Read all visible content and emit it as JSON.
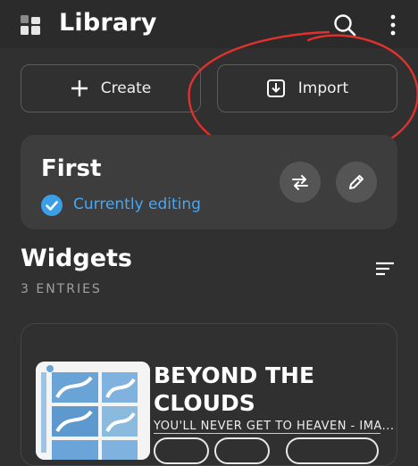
{
  "header": {
    "title": "Library",
    "logo_icon": "library-grid-icon",
    "search_icon": "search-icon",
    "menu_icon": "more-vert-icon"
  },
  "actions": {
    "create_label": "Create",
    "import_label": "Import"
  },
  "workspace": {
    "name": "First",
    "status": "Currently editing"
  },
  "widgets": {
    "title": "Widgets",
    "count": "3 ENTRIES",
    "items": [
      {
        "song_title": "BEYOND THE CLOUDS",
        "artist_line": "YOU'LL NEVER GET TO HEAVEN - IMA..."
      }
    ]
  },
  "colors": {
    "accent": "#4aa6f0",
    "background": "#303030",
    "card": "#3d3d3d",
    "annotation": "#e0312d"
  }
}
